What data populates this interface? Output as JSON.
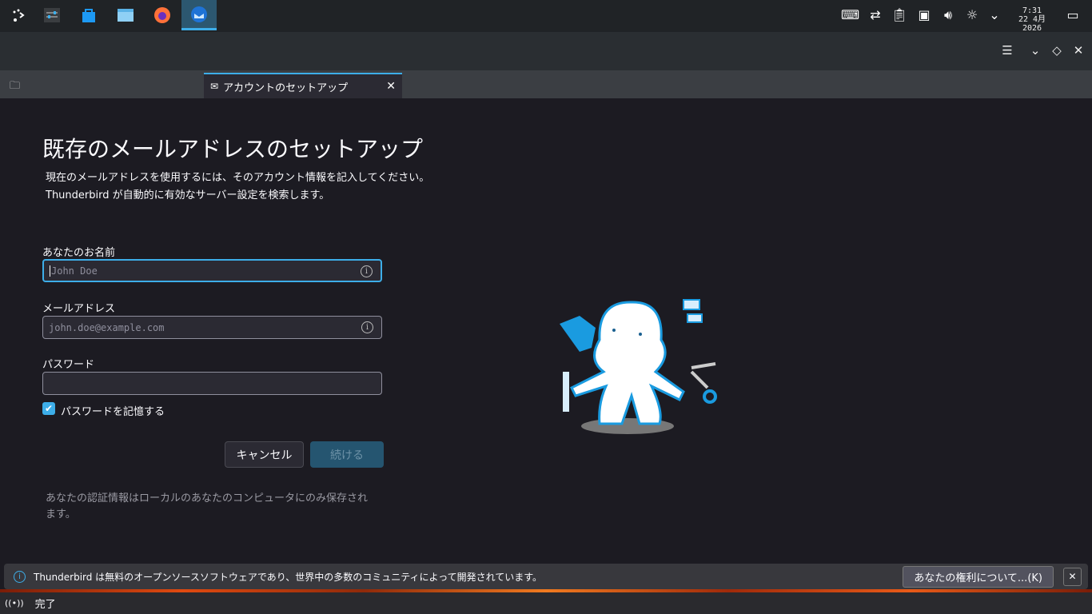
{
  "taskbar": {
    "apps": [
      {
        "name": "app-launcher"
      },
      {
        "name": "system-settings"
      },
      {
        "name": "discover-store"
      },
      {
        "name": "file-manager"
      },
      {
        "name": "firefox"
      },
      {
        "name": "thunderbird"
      }
    ],
    "tray": [
      "keyboard-icon",
      "network-icon",
      "clipboard-icon",
      "display-icon",
      "volume-icon",
      "brightness-icon",
      "chevron-down-icon"
    ],
    "clock_time": "7:31",
    "clock_date": "22 4月 2026"
  },
  "tab": {
    "label": "アカウントのセットアップ"
  },
  "page": {
    "title": "既存のメールアドレスのセットアップ",
    "desc1": "現在のメールアドレスを使用するには、そのアカウント情報を記入してください。",
    "desc2": "Thunderbird が自動的に有効なサーバー設定を検索します。",
    "name_label": "あなたのお名前",
    "name_placeholder": "John Doe",
    "email_label": "メールアドレス",
    "email_placeholder": "john.doe@example.com",
    "password_label": "パスワード",
    "password_value": "",
    "remember_label": "パスワードを記憶する",
    "remember_checked": true,
    "cancel": "キャンセル",
    "continue": "続ける",
    "footnote1": "あなたの認証情報はローカルのあなたのコンピュータにのみ保存され",
    "footnote2": "ます。"
  },
  "notification": {
    "text": "Thunderbird は無料のオープンソースソフトウェアであり、世界中の多数のコミュニティによって開発されています。",
    "button": "あなたの権利について...(K)"
  },
  "status": {
    "text": "完了"
  },
  "colors": {
    "accent": "#3daee9",
    "continue_bg": "#255570"
  }
}
